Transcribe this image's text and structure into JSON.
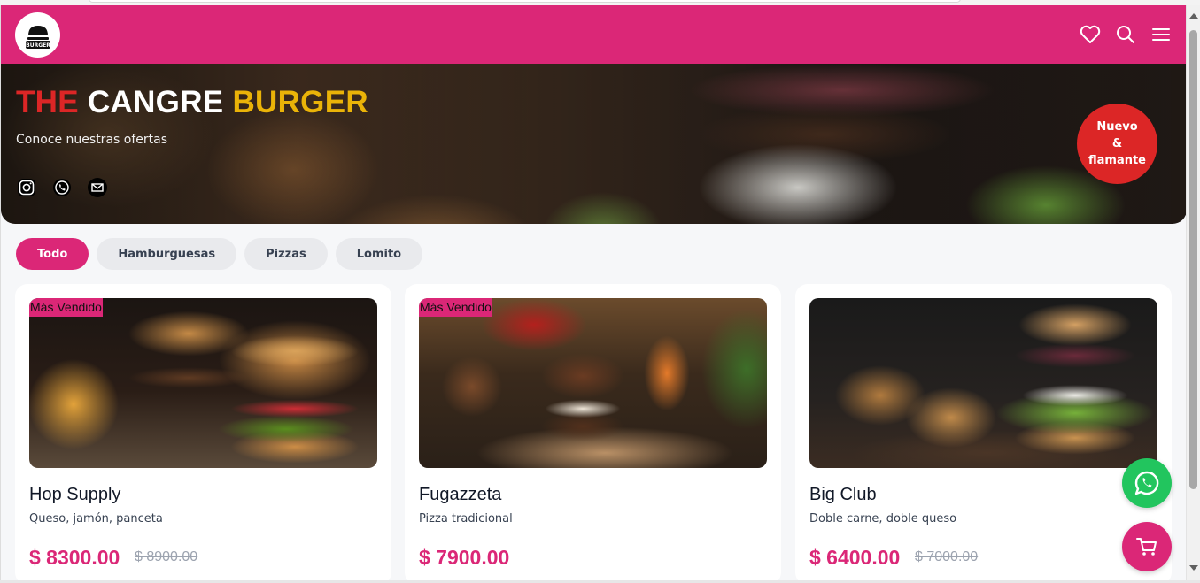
{
  "header": {
    "logo_text": "BURGER",
    "icons": [
      "heart-icon",
      "search-icon",
      "menu-icon"
    ]
  },
  "hero": {
    "title_part1": "THE",
    "title_part2": "CANGRE",
    "title_part3": "BURGER",
    "subtitle": "Conoce nuestras ofertas",
    "social_icons": [
      "instagram-icon",
      "whatsapp-icon",
      "email-icon"
    ],
    "badge_line1": "Nuevo",
    "badge_line2": "&",
    "badge_line3": "flamante"
  },
  "filters": [
    {
      "label": "Todo",
      "active": true
    },
    {
      "label": "Hamburguesas",
      "active": false
    },
    {
      "label": "Pizzas",
      "active": false
    },
    {
      "label": "Lomito",
      "active": false
    }
  ],
  "products": [
    {
      "title": "Hop Supply",
      "description": "Queso, jamón, panceta",
      "price": "$ 8300.00",
      "old_price": "$ 8900.00",
      "tag": "Más Vendido"
    },
    {
      "title": "Fugazzeta",
      "description": "Pizza tradicional",
      "price": "$ 7900.00",
      "old_price": "",
      "tag": "Más Vendido"
    },
    {
      "title": "Big Club",
      "description": "Doble carne, doble queso",
      "price": "$ 6400.00",
      "old_price": "$ 7000.00",
      "tag": ""
    }
  ],
  "floating_buttons": [
    "whatsapp-icon",
    "cart-icon"
  ],
  "colors": {
    "brand": "#db2777",
    "title_red": "#dc2626",
    "title_yellow": "#eab308",
    "whatsapp": "#22c55e"
  }
}
